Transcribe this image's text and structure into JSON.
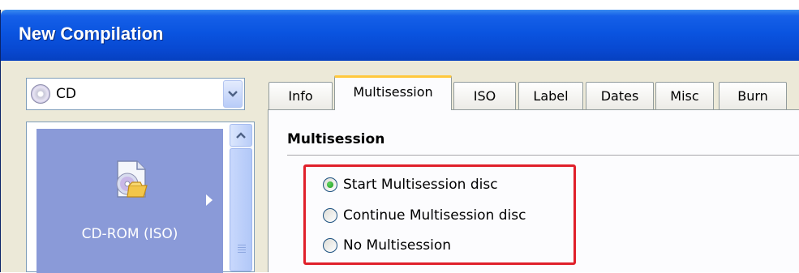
{
  "window": {
    "title": "New Compilation"
  },
  "media_select": {
    "value": "CD",
    "icon": "cd-icon"
  },
  "compilation_list": {
    "items": [
      {
        "label": "CD-ROM (ISO)",
        "icon": "cd-document-icon"
      }
    ]
  },
  "tabs": [
    {
      "label": "Info"
    },
    {
      "label": "Multisession",
      "active": true
    },
    {
      "label": "ISO"
    },
    {
      "label": "Label"
    },
    {
      "label": "Dates"
    },
    {
      "label": "Misc"
    },
    {
      "label": "Burn"
    }
  ],
  "multisession": {
    "title": "Multisession",
    "options": [
      {
        "label": "Start Multisession disc",
        "selected": true
      },
      {
        "label": "Continue Multisession disc",
        "selected": false
      },
      {
        "label": "No Multisession",
        "selected": false
      }
    ]
  },
  "colors": {
    "titlebar": "#0a54e0",
    "highlight": "#e0202a",
    "list_selection": "#8a9ad8"
  }
}
